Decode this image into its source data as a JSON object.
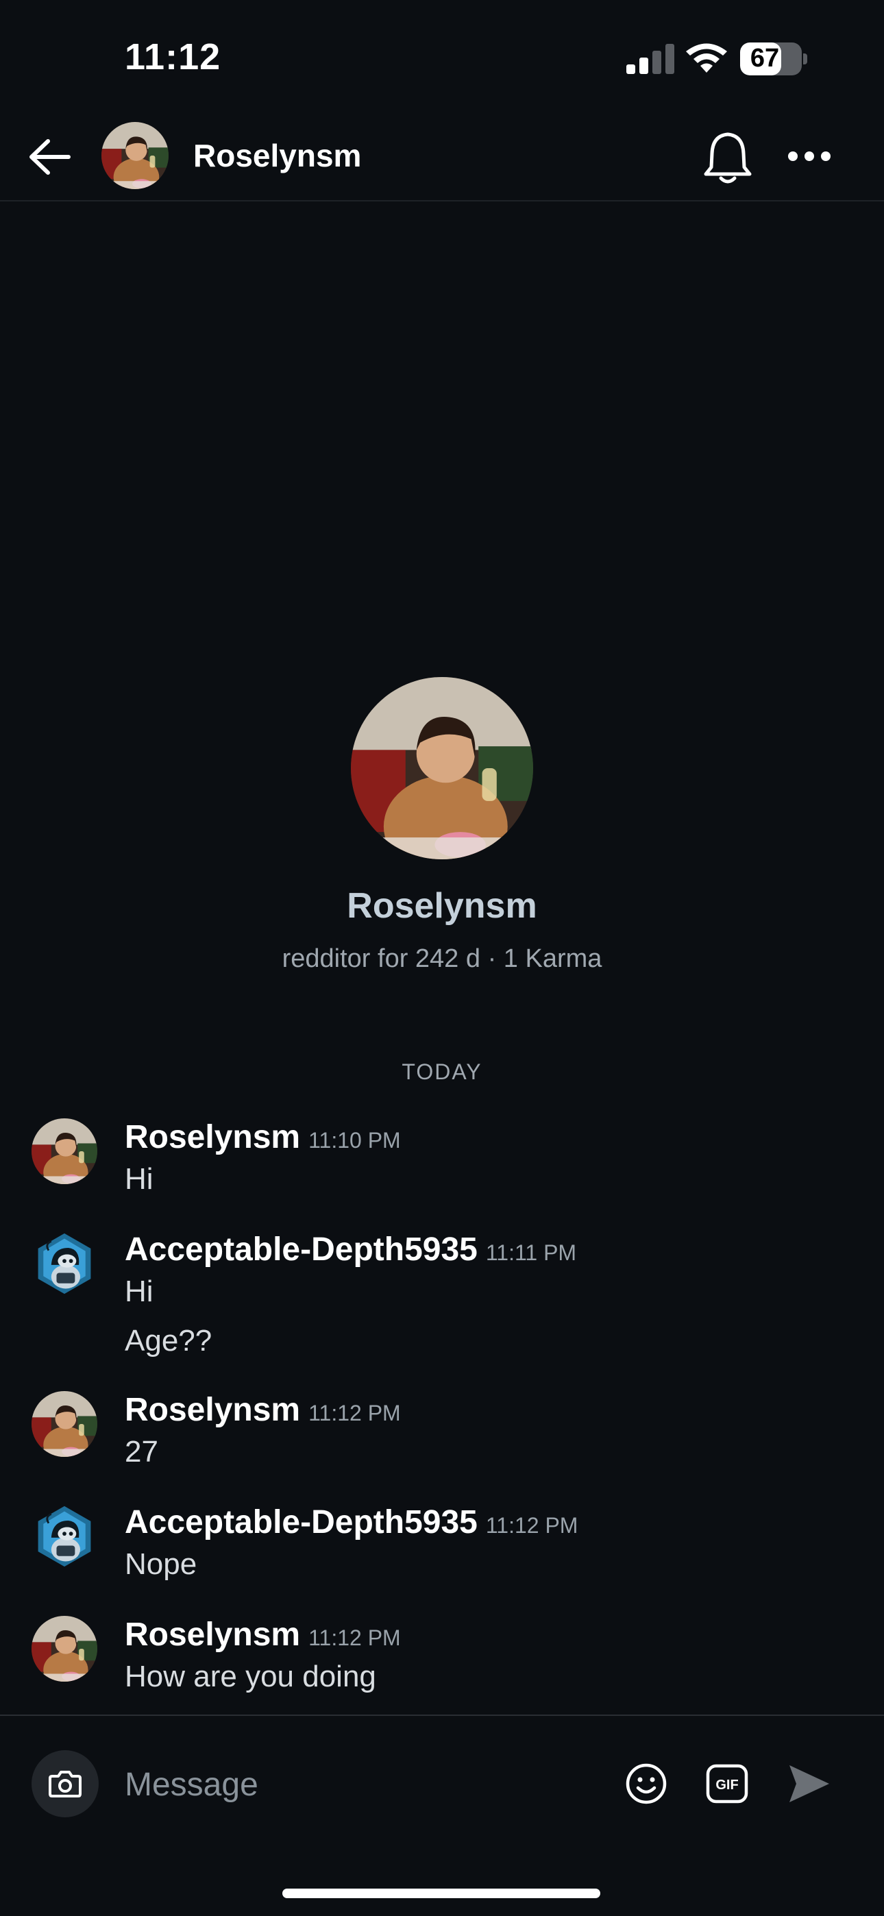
{
  "status_bar": {
    "time": "11:12",
    "battery": "67",
    "battery_level": 0.67
  },
  "header": {
    "username": "Roselynsm",
    "avatar_icon": "user-avatar-photo",
    "back_icon": "arrow-left-icon",
    "bell_icon": "bell-icon",
    "more_icon": "more-horizontal-icon"
  },
  "profile": {
    "name": "Roselynsm",
    "meta": "redditor for 242 d · 1 Karma"
  },
  "day_divider": "TODAY",
  "messages": [
    {
      "author": "Roselynsm",
      "time": "11:10 PM",
      "lines": [
        "Hi"
      ]
    },
    {
      "author": "Acceptable-Depth5935",
      "time": "11:11 PM",
      "lines": [
        "Hi",
        "Age??"
      ]
    },
    {
      "author": "Roselynsm",
      "time": "11:12 PM",
      "lines": [
        "27"
      ]
    },
    {
      "author": "Acceptable-Depth5935",
      "time": "11:12 PM",
      "lines": [
        "Nope"
      ]
    },
    {
      "author": "Roselynsm",
      "time": "11:12 PM",
      "lines": [
        "How are you doing"
      ]
    }
  ],
  "composer": {
    "placeholder": "Message",
    "gif_label": "GIF",
    "camera_icon": "camera-icon",
    "emoji_icon": "emoji-icon",
    "send_icon": "send-icon"
  },
  "colors": {
    "background": "#0b0e12",
    "accent_blue": "#3aa0d8",
    "muted_text": "#9aa3ab"
  }
}
